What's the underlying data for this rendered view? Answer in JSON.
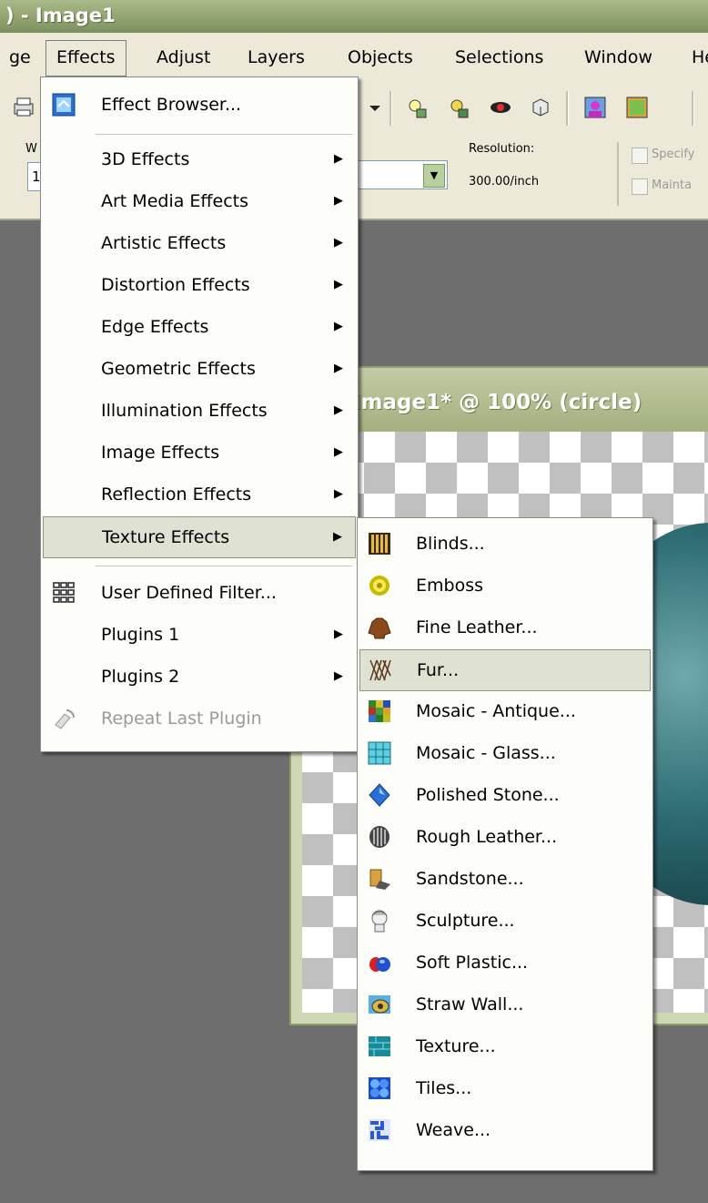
{
  "title_bar": {
    "text": ") - Image1"
  },
  "menubar": {
    "items": [
      "ge",
      "Effects",
      "Adjust",
      "Layers",
      "Objects",
      "Selections",
      "Window",
      "He"
    ]
  },
  "options": {
    "width_label": "W",
    "width_value": "1",
    "resolution_label": "Resolution:",
    "resolution_value": "300.00/inch",
    "specify_label": "Specify",
    "maintain_label": "Mainta"
  },
  "image_window": {
    "title": "Image1* @ 100% (circle)"
  },
  "effects_menu": {
    "items": [
      {
        "label": "Effect Browser...",
        "icon": "effect-browser-icon"
      },
      {
        "label": "3D Effects",
        "submenu": true
      },
      {
        "label": "Art Media Effects",
        "submenu": true
      },
      {
        "label": "Artistic Effects",
        "submenu": true
      },
      {
        "label": "Distortion Effects",
        "submenu": true
      },
      {
        "label": "Edge Effects",
        "submenu": true
      },
      {
        "label": "Geometric Effects",
        "submenu": true
      },
      {
        "label": "Illumination Effects",
        "submenu": true
      },
      {
        "label": "Image Effects",
        "submenu": true
      },
      {
        "label": "Reflection Effects",
        "submenu": true
      },
      {
        "label": "Texture Effects",
        "submenu": true,
        "selected": true
      },
      {
        "label": "User Defined Filter...",
        "icon": "grid-filter-icon"
      },
      {
        "label": "Plugins 1",
        "submenu": true
      },
      {
        "label": "Plugins 2",
        "submenu": true
      },
      {
        "label": "Repeat Last Plugin",
        "disabled": true,
        "icon": "repeat-plugin-icon"
      }
    ]
  },
  "texture_submenu": {
    "items": [
      {
        "label": "Blinds...",
        "icon": "blinds-icon"
      },
      {
        "label": "Emboss",
        "icon": "emboss-icon"
      },
      {
        "label": "Fine Leather...",
        "icon": "fine-leather-icon"
      },
      {
        "label": "Fur...",
        "icon": "fur-icon",
        "selected": true
      },
      {
        "label": "Mosaic - Antique...",
        "icon": "mosaic-antique-icon"
      },
      {
        "label": "Mosaic - Glass...",
        "icon": "mosaic-glass-icon"
      },
      {
        "label": "Polished Stone...",
        "icon": "polished-stone-icon"
      },
      {
        "label": "Rough Leather...",
        "icon": "rough-leather-icon"
      },
      {
        "label": "Sandstone...",
        "icon": "sandstone-icon"
      },
      {
        "label": "Sculpture...",
        "icon": "sculpture-icon"
      },
      {
        "label": "Soft Plastic...",
        "icon": "soft-plastic-icon"
      },
      {
        "label": "Straw Wall...",
        "icon": "straw-wall-icon"
      },
      {
        "label": "Texture...",
        "icon": "texture-icon"
      },
      {
        "label": "Tiles...",
        "icon": "tiles-icon"
      },
      {
        "label": "Weave...",
        "icon": "weave-icon"
      }
    ]
  }
}
